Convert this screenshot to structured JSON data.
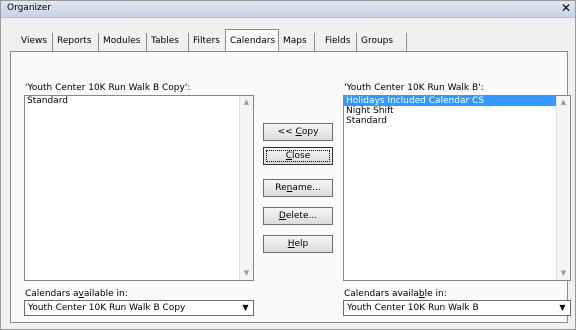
{
  "window": {
    "title": "Organizer",
    "close_glyph": "✕"
  },
  "tabs": [
    {
      "label": "Views"
    },
    {
      "label": "Reports"
    },
    {
      "label": "Modules"
    },
    {
      "label": "Tables"
    },
    {
      "label": "Filters"
    },
    {
      "label": "Calendars"
    },
    {
      "label": "Maps"
    },
    {
      "label": "Fields"
    },
    {
      "label": "Groups"
    }
  ],
  "left_pane": {
    "label": "'Youth Center 10K Run Walk B Copy':",
    "items": [
      "Standard"
    ],
    "available_label": "Calendars available in:",
    "available_value": "Youth Center 10K Run Walk B Copy"
  },
  "right_pane": {
    "label": "'Youth Center 10K Run Walk B':",
    "items": [
      "Holidays Included Calendar CS",
      "Night Shift",
      "Standard"
    ],
    "selected_index": 0,
    "available_label": "Calendars available in:",
    "available_value": "Youth Center 10K Run Walk B"
  },
  "buttons": {
    "copy": "<< Copy",
    "close": "Close",
    "rename": "Rename...",
    "delete": "Delete...",
    "help": "Help"
  },
  "icons": {
    "scroll_up": "▲",
    "scroll_down": "▼",
    "dropdown": "▼"
  },
  "colors": {
    "selection": "#3399ff",
    "titlebar": "#c6d3e4"
  }
}
